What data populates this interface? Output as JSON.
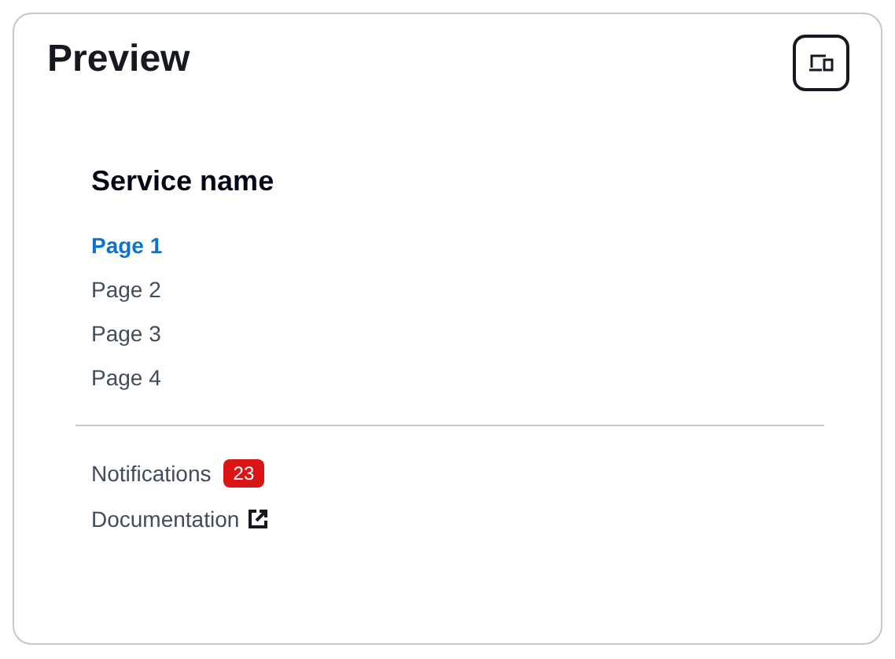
{
  "title": "Preview",
  "nav": {
    "service_name": "Service name",
    "pages": [
      {
        "label": "Page 1",
        "selected": true
      },
      {
        "label": "Page 2",
        "selected": false
      },
      {
        "label": "Page 3",
        "selected": false
      },
      {
        "label": "Page 4",
        "selected": false
      }
    ]
  },
  "utility_links": [
    {
      "kind": "badge",
      "label": "Notifications",
      "badge": "23"
    },
    {
      "kind": "external",
      "label": "Documentation"
    }
  ]
}
